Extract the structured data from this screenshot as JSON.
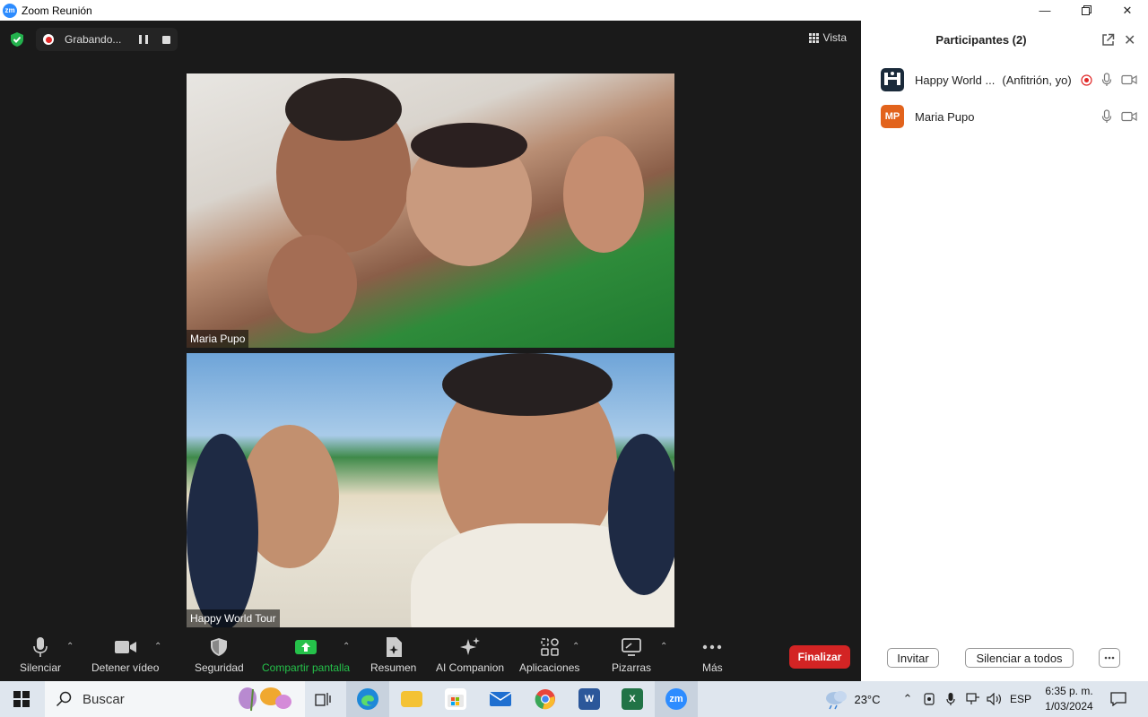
{
  "window": {
    "title": "Zoom Reunión",
    "logo": "zm"
  },
  "meeting": {
    "recording_label": "Grabando...",
    "view_label": "Vista",
    "tiles": [
      {
        "name": "Maria Pupo"
      },
      {
        "name": "Happy World Tour"
      }
    ]
  },
  "toolbar": {
    "mute": "Silenciar",
    "stop_video": "Detener vídeo",
    "security": "Seguridad",
    "share": "Compartir pantalla",
    "summary": "Resumen",
    "ai": "AI Companion",
    "apps": "Aplicaciones",
    "whiteboards": "Pizarras",
    "more": "Más",
    "end": "Finalizar",
    "accent_green": "#25c14a",
    "end_color": "#d32424"
  },
  "panel": {
    "title": "Participantes (2)",
    "participants": [
      {
        "name": "Happy World ...",
        "role": "(Anfitrión, yo)",
        "avatar_bg": "#1a2a3a"
      },
      {
        "name": "Maria Pupo",
        "initials": "MP",
        "avatar_bg": "#e2631c"
      }
    ],
    "invite": "Invitar",
    "mute_all": "Silenciar a todos"
  },
  "taskbar": {
    "search_placeholder": "Buscar",
    "zoom_app": "zm",
    "temperature": "23°C",
    "language": "ESP",
    "time": "6:35 p. m.",
    "date": "1/03/2024"
  }
}
